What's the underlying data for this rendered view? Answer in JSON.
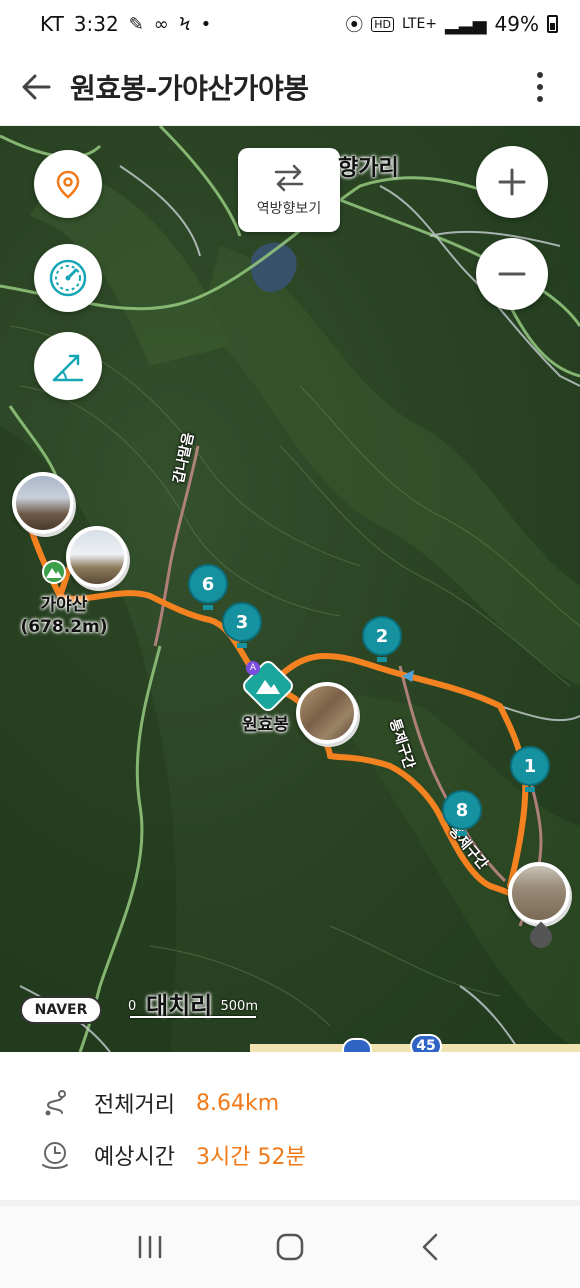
{
  "status": {
    "carrier": "KT",
    "time": "3:32",
    "network": "LTE+",
    "battery": "49%",
    "icons": [
      "photo-icon",
      "voicemail-icon",
      "lightning-icon",
      "dot-icon",
      "location-icon",
      "hd-icon",
      "signal-icon",
      "battery-icon"
    ]
  },
  "header": {
    "title": "원효봉-가야산가야봉",
    "icons": [
      "back-arrow-icon",
      "more-vertical-icon"
    ]
  },
  "map": {
    "reverse_label": "역방향보기",
    "labels": {
      "village_top": "향가리",
      "trail_left": "갑나말음",
      "trail_mid": "통제구간",
      "trail_low": "통제구간",
      "village_bottom": "대치리",
      "peak_gaya": "가야산",
      "peak_gaya_height": "(678.2m)",
      "peak_wonhyo": "원효봉"
    },
    "waypoints": [
      "6",
      "3",
      "2",
      "1",
      "8"
    ],
    "scale": {
      "start": "0",
      "end": "500m"
    },
    "naver": "NAVER",
    "road_numbers": [
      "45"
    ],
    "colors": {
      "route": "#f58220",
      "waypoint": "#15919f",
      "accent": "#f07a1a"
    }
  },
  "info": {
    "distance_label": "전체거리",
    "distance_value": "8.64km",
    "time_label": "예상시간",
    "time_value": "3시간 52분"
  }
}
